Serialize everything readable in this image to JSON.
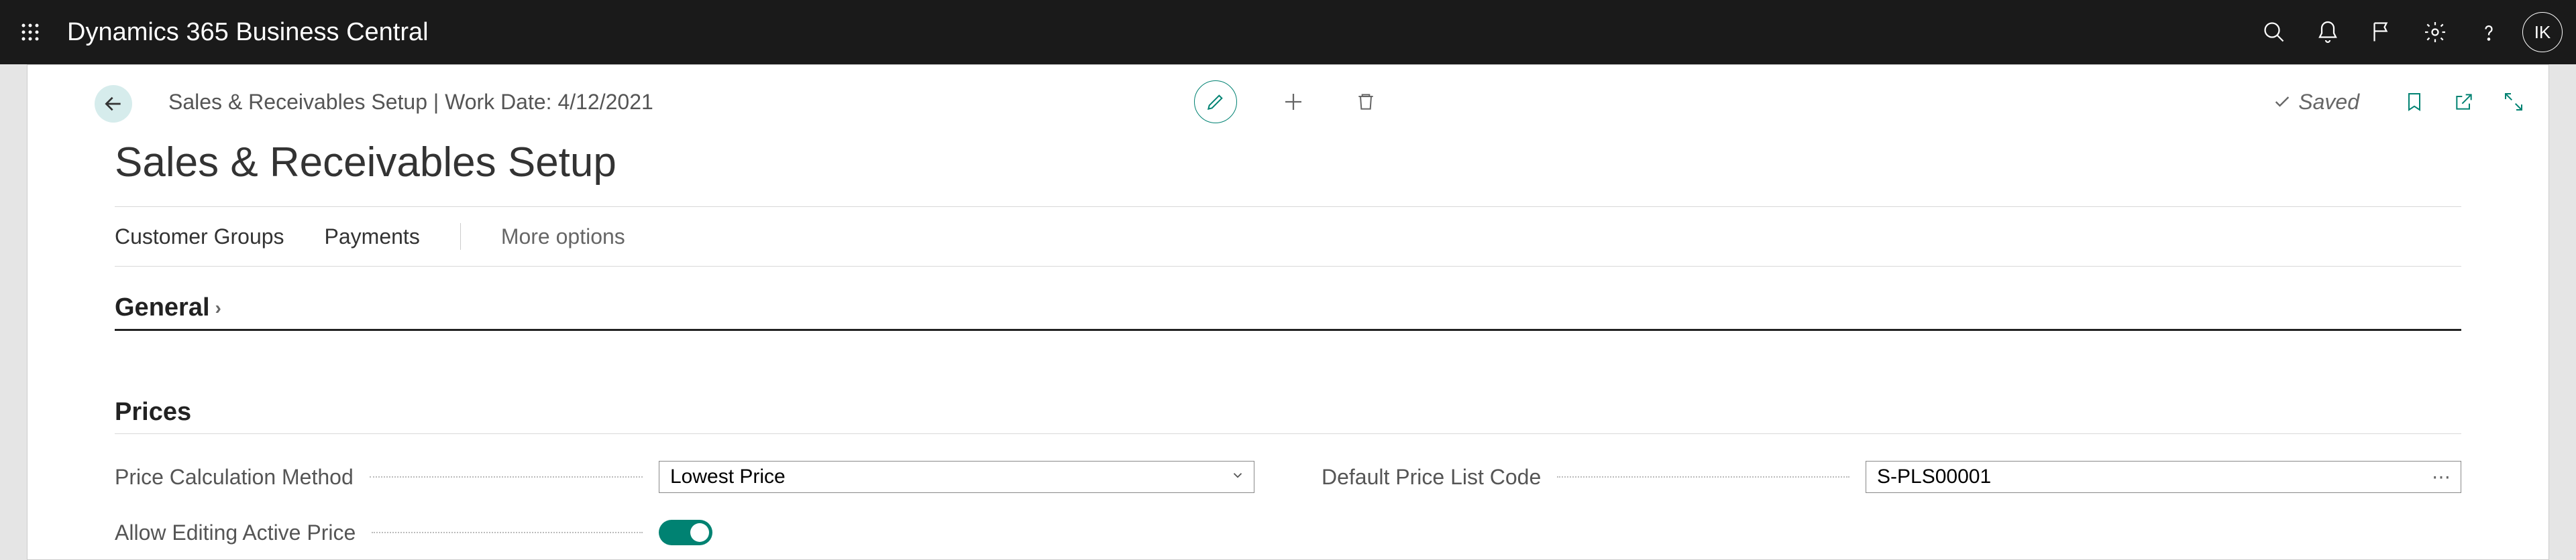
{
  "header": {
    "app_title": "Dynamics 365 Business Central",
    "avatar_initials": "IK"
  },
  "page": {
    "breadcrumb": "Sales & Receivables Setup | Work Date: 4/12/2021",
    "title": "Sales & Receivables Setup",
    "saved_label": "Saved"
  },
  "menu": {
    "customer_groups": "Customer Groups",
    "payments": "Payments",
    "more_options": "More options"
  },
  "sections": {
    "general": "General",
    "prices": "Prices"
  },
  "fields": {
    "price_calc_method": {
      "label": "Price Calculation Method",
      "value": "Lowest Price"
    },
    "allow_editing_active_price": {
      "label": "Allow Editing Active Price",
      "value": true
    },
    "default_price_list_code": {
      "label": "Default Price List Code",
      "value": "S-PLS00001"
    }
  }
}
